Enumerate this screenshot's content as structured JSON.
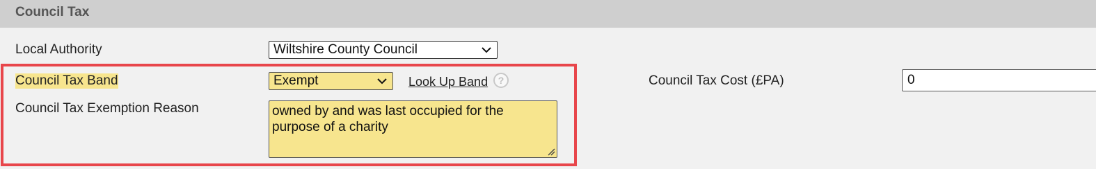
{
  "section": {
    "title": "Council Tax"
  },
  "local_authority": {
    "label": "Local Authority",
    "value": "Wiltshire County Council"
  },
  "council_tax_band": {
    "label": "Council Tax Band",
    "value": "Exempt",
    "lookup_link": "Look Up Band",
    "help_glyph": "?"
  },
  "exemption_reason": {
    "label": "Council Tax Exemption Reason",
    "value": "owned by and was last occupied for the purpose of a charity"
  },
  "council_tax_cost": {
    "label": "Council Tax Cost (£PA)",
    "value": "0"
  },
  "colors": {
    "highlight": "#f7e58e",
    "annotation_border": "#e8464b",
    "header_bg": "#cfcfcf"
  },
  "icons": [
    "chevron-down-icon",
    "help-icon",
    "resize-handle-icon"
  ]
}
